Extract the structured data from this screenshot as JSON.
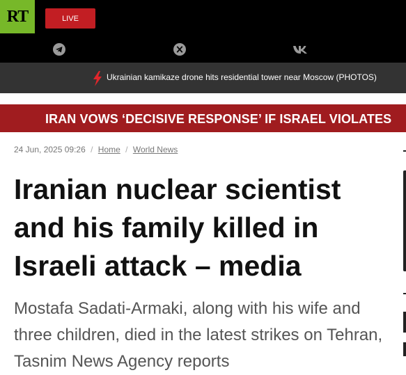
{
  "header": {
    "logo_text": "RT",
    "live_label": "LIVE",
    "social_icons": [
      "telegram-icon",
      "x-icon",
      "vk-icon"
    ],
    "colors": {
      "logo_bg": "#77b829",
      "live_bg": "#c21e23",
      "bar_bg": "#000000"
    }
  },
  "ticker": {
    "icon": "lightning-bolt-icon",
    "text": "Ukrainian kamikaze drone hits residential tower near Moscow (PHOTOS)",
    "colors": {
      "bg": "#333333",
      "bolt": "#e0262b"
    }
  },
  "banner": {
    "text": "IRAN VOWS ‘DECISIVE RESPONSE’ IF ISRAEL VIOLATES",
    "colors": {
      "bg": "#a01c1f"
    }
  },
  "article": {
    "date": "24 Jun, 2025 09:26",
    "breadcrumbs": [
      "Home",
      "World News"
    ],
    "title": "Iranian nuclear scientist and his family killed in Israeli attack – media",
    "summary": "Mostafa Sadati-Armaki, along with his wife and three children, died in the latest strikes on Tehran, Tasnim News Agency reports"
  }
}
